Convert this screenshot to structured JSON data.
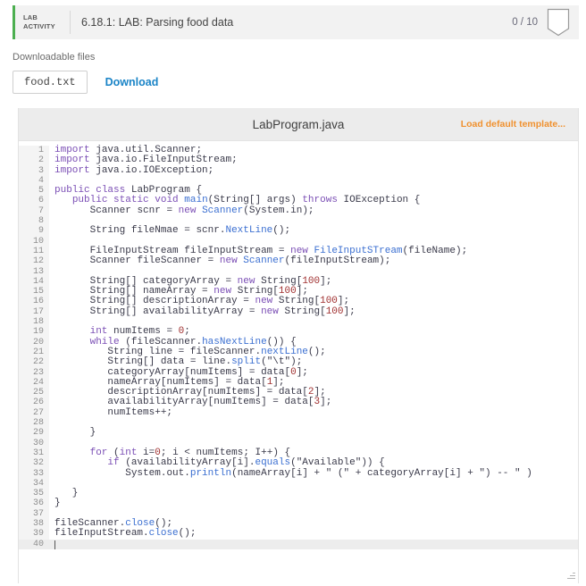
{
  "activity": {
    "tag": "LAB ACTIVITY",
    "tag_line1": "LAB",
    "tag_line2": "ACTIVITY",
    "title": "6.18.1: LAB: Parsing food data",
    "score": "0 / 10",
    "accent_color": "#4caf50",
    "badge_icon": "score-badge-icon"
  },
  "downloads": {
    "label": "Downloadable files",
    "file_name": "food.txt",
    "download_label": "Download"
  },
  "editor": {
    "filename": "LabProgram.java",
    "load_template_label": "Load default template...",
    "link_color": "#f0912f",
    "active_line": 40,
    "total_lines": 40,
    "lines": [
      {
        "n": 1,
        "text": "import java.util.Scanner;"
      },
      {
        "n": 2,
        "text": "import java.io.FileInputStream;"
      },
      {
        "n": 3,
        "text": "import java.io.IOException;"
      },
      {
        "n": 4,
        "text": ""
      },
      {
        "n": 5,
        "text": "public class LabProgram {"
      },
      {
        "n": 6,
        "text": "   public static void main(String[] args) throws IOException {"
      },
      {
        "n": 7,
        "text": "      Scanner scnr = new Scanner(System.in);"
      },
      {
        "n": 8,
        "text": ""
      },
      {
        "n": 9,
        "text": "      String fileNmae = scnr.NextLine();"
      },
      {
        "n": 10,
        "text": ""
      },
      {
        "n": 11,
        "text": "      FileInputStream fileInputStream = new FileInputSTream(fileName);"
      },
      {
        "n": 12,
        "text": "      Scanner fileScanner = new Scanner(fileInputStream);"
      },
      {
        "n": 13,
        "text": ""
      },
      {
        "n": 14,
        "text": "      String[] categoryArray = new String[100];"
      },
      {
        "n": 15,
        "text": "      String[] nameArray = new String[100];"
      },
      {
        "n": 16,
        "text": "      String[] descriptionArray = new String[100];"
      },
      {
        "n": 17,
        "text": "      String[] availabilityArray = new String[100];"
      },
      {
        "n": 18,
        "text": ""
      },
      {
        "n": 19,
        "text": "      int numItems = 0;"
      },
      {
        "n": 20,
        "text": "      while (fileScanner.hasNextLine()) {"
      },
      {
        "n": 21,
        "text": "         String line = fileScanner.nextLine();"
      },
      {
        "n": 22,
        "text": "         String[] data = line.split(\"\\t\");"
      },
      {
        "n": 23,
        "text": "         categoryArray[numItems] = data[0];"
      },
      {
        "n": 24,
        "text": "         nameArray[numItems] = data[1];"
      },
      {
        "n": 25,
        "text": "         descriptionArray[numItems] = data[2];"
      },
      {
        "n": 26,
        "text": "         availabilityArray[numItems] = data[3];"
      },
      {
        "n": 27,
        "text": "         numItems++;"
      },
      {
        "n": 28,
        "text": ""
      },
      {
        "n": 29,
        "text": "      }"
      },
      {
        "n": 30,
        "text": ""
      },
      {
        "n": 31,
        "text": "      for (int i=0; i < numItems; I++) {"
      },
      {
        "n": 32,
        "text": "         if (availabilityArray[i].equals(\"Available\")) {"
      },
      {
        "n": 33,
        "text": "            System.out.println(nameArray[i] + \" (\" + categoryArray[i] + \") -- \" )"
      },
      {
        "n": 34,
        "text": ""
      },
      {
        "n": 35,
        "text": "   }"
      },
      {
        "n": 36,
        "text": "}"
      },
      {
        "n": 37,
        "text": ""
      },
      {
        "n": 38,
        "text": "fileScanner.close();"
      },
      {
        "n": 39,
        "text": "fileInputStream.close();"
      },
      {
        "n": 40,
        "text": ""
      }
    ]
  }
}
